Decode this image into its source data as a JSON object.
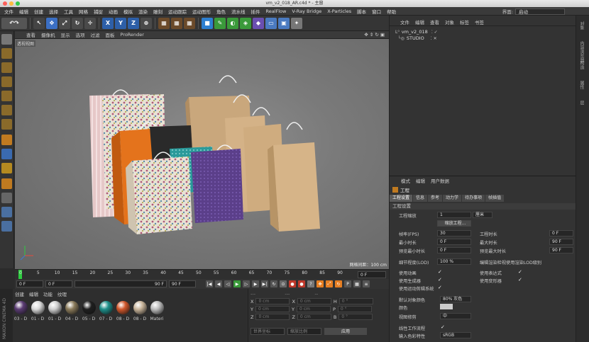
{
  "window": {
    "title": "vm_v2_018_AR.c4d * - 主窗"
  },
  "menu": [
    "文件",
    "编辑",
    "创建",
    "选择",
    "工具",
    "网格",
    "捕捉",
    "动画",
    "模拟",
    "渲染",
    "雕刻",
    "运动跟踪",
    "运动图形",
    "角色",
    "流水线",
    "插件",
    "RealFlow",
    "V-Ray Bridge",
    "X-Particles",
    "脚本",
    "窗口",
    "帮助"
  ],
  "layout": {
    "label": "界面:",
    "value": "启动"
  },
  "viewport": {
    "menu": [
      "查看",
      "摄像机",
      "显示",
      "选项",
      "过滤",
      "面板",
      "ProRender"
    ],
    "name": "透视视图",
    "grid_spacing": "网格间距：100 cm"
  },
  "timeline": {
    "ticks": [
      "0",
      "5",
      "10",
      "15",
      "20",
      "25",
      "30",
      "35",
      "40",
      "45",
      "50",
      "55",
      "60",
      "65",
      "70",
      "75",
      "80",
      "85",
      "90"
    ],
    "frame_end_field": "0 F",
    "start": "0 F",
    "min": "0 F",
    "max": "90 F",
    "end": "90 F"
  },
  "materials": {
    "menu": [
      "创建",
      "编辑",
      "功能",
      "纹理"
    ],
    "items": [
      {
        "label": "03 - D",
        "color": "#5a3b73"
      },
      {
        "label": "01 - D",
        "color": "#d9d9d9"
      },
      {
        "label": "01 - D",
        "color": "#cfcfcf"
      },
      {
        "label": "04 - D",
        "color": "#8a7a5a"
      },
      {
        "label": "05 - D",
        "color": "#1f1f1f"
      },
      {
        "label": "07 - D",
        "color": "#1d8f8a"
      },
      {
        "label": "08 - D",
        "color": "#d0562a"
      },
      {
        "label": "08 - D",
        "color": "#c8b49a"
      },
      {
        "label": "Materi",
        "color": "#bdbdbd"
      }
    ],
    "logo": "MAXON CINEMA 4D"
  },
  "coords": {
    "rows": [
      {
        "a": "X",
        "av": "0 cm",
        "b": "X",
        "bv": "0 cm",
        "c": "H",
        "cv": "0 °"
      },
      {
        "a": "Y",
        "av": "0 cm",
        "b": "Y",
        "bv": "0 cm",
        "c": "P",
        "cv": "0 °"
      },
      {
        "a": "Z",
        "av": "0 cm",
        "b": "Z",
        "bv": "0 cm",
        "c": "B",
        "cv": "0 °"
      }
    ],
    "mode1": "世界坐标",
    "mode2": "缩放比例",
    "apply": "应用"
  },
  "objects": {
    "menu": [
      "文件",
      "编辑",
      "查看",
      "对象",
      "标签",
      "书签"
    ],
    "items": [
      "vm_v2_018",
      "STUDIO"
    ]
  },
  "attributes": {
    "menu": [
      "模式",
      "编辑",
      "用户数据"
    ],
    "title": "工程",
    "tabs": [
      "工程设置",
      "信息",
      "参考",
      "动力学",
      "待办事项",
      "帧插值"
    ],
    "section": "工程设置",
    "scale_label": "工程缩放",
    "scale_value": "1",
    "scale_unit": "厘米",
    "scale_btn": "缩放工程...",
    "fps_label": "帧率(FPS)",
    "fps": "30",
    "project_time_label": "工程时长",
    "project_time": "0 F",
    "min_time_label": "最小时长",
    "min_time": "0 F",
    "max_time_label": "最大时长",
    "max_time": "90 F",
    "preview_min_label": "预览最小时长",
    "preview_min": "0 F",
    "preview_max_label": "预览最大时长",
    "preview_max": "90 F",
    "lod_label": "细节程度(LOD)",
    "lod": "100 %",
    "lod_render_label": "编辑渲染检视使用渲染LOD级别",
    "use_anim": "使用动画",
    "use_expr": "使用表达式",
    "use_gen": "使用生成器",
    "use_deform": "使用变形器",
    "use_motion": "使用运动剪辑系统",
    "default_color_label": "默认对象颜色",
    "default_color": "80% 灰色",
    "color_label": "颜色",
    "view_clip_label": "视图修剪",
    "view_clip": "中",
    "linear_label": "线性工作流程",
    "input_profile_label": "输入色彩特性",
    "input_profile": "sRGB"
  },
  "side_tabs": [
    "对象",
    "内容浏览器",
    "构造",
    "属性",
    "层"
  ]
}
